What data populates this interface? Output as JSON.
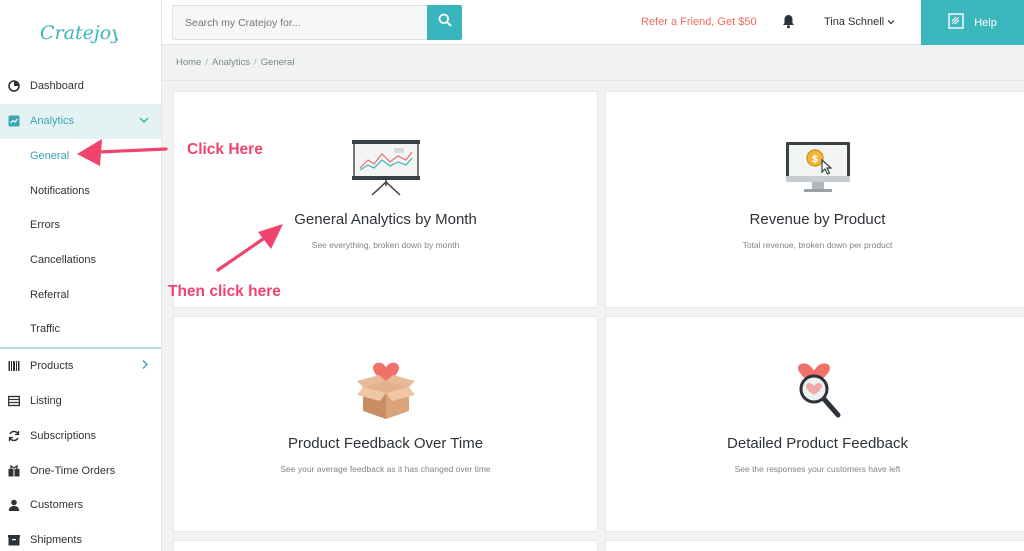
{
  "brand": {
    "logo_text": "Cratejoy"
  },
  "topbar": {
    "search_placeholder": "Search my Cratejoy for...",
    "refer_label": "Refer a Friend, Get $50",
    "user_name": "Tina Schnell",
    "help_label": "Help"
  },
  "sidebar": {
    "dashboard": "Dashboard",
    "analytics": "Analytics",
    "sub": {
      "general": "General",
      "notifications": "Notifications",
      "errors": "Errors",
      "cancellations": "Cancellations",
      "referral": "Referral",
      "traffic": "Traffic"
    },
    "products": "Products",
    "listing": "Listing",
    "subscriptions": "Subscriptions",
    "one_time_orders": "One-Time Orders",
    "customers": "Customers",
    "shipments": "Shipments"
  },
  "breadcrumb": {
    "home": "Home",
    "analytics": "Analytics",
    "general": "General"
  },
  "cards": {
    "general_month": {
      "title": "General Analytics by Month",
      "subtitle": "See everything, broken down by month"
    },
    "revenue_product": {
      "title": "Revenue by Product",
      "subtitle": "Total revenue, broken down per product"
    },
    "feedback_time": {
      "title": "Product Feedback Over Time",
      "subtitle": "See your average feedback as it has changed over time"
    },
    "detailed_feedback": {
      "title": "Detailed Product Feedback",
      "subtitle": "See the responses your customers have left"
    }
  },
  "annotations": {
    "click_here": "Click Here",
    "then_click_here": "Then click here"
  },
  "colors": {
    "accent": "#3ab5bd",
    "refer": "#f06c5c",
    "annotation": "#f0446e"
  }
}
